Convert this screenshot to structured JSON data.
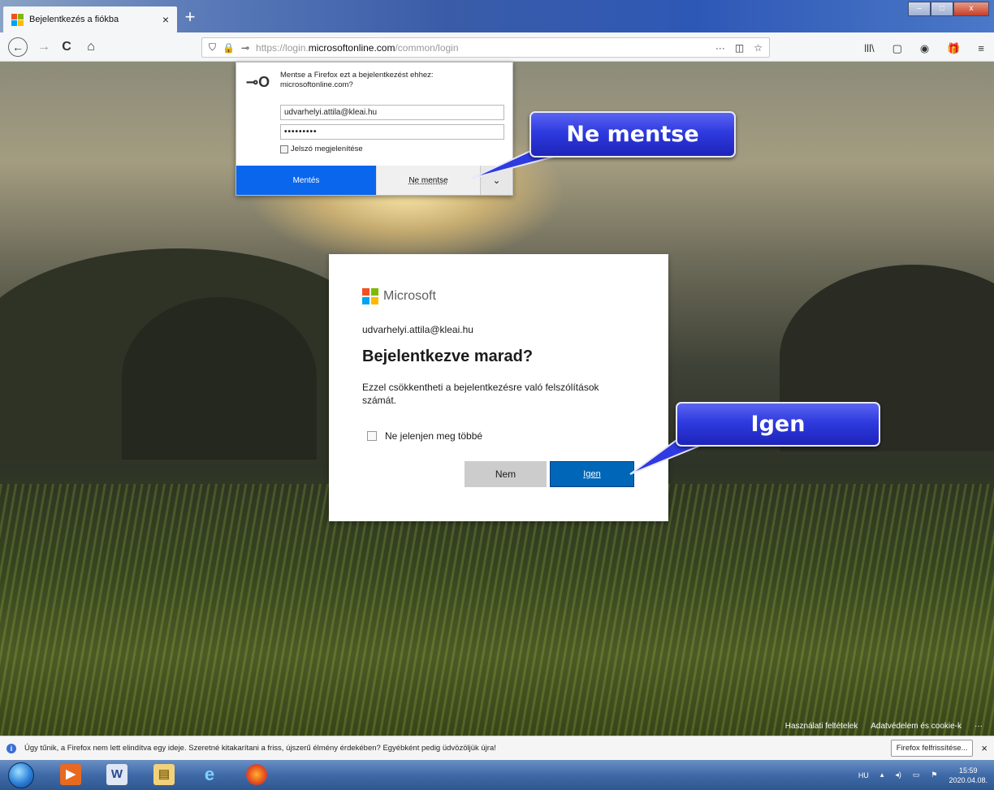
{
  "browser": {
    "tab_title": "Bejelentkezés a fiókba",
    "tab_close": "×",
    "new_tab": "+",
    "nav": {
      "back": "←",
      "forward": "→",
      "reload": "C",
      "home": "⌂"
    },
    "url": {
      "prefix": "https://login.",
      "host": "microsoftonline.com",
      "path": "/common/login"
    },
    "url_actions": [
      "···",
      "◫",
      "☆"
    ],
    "right_tools": [
      "lll\\",
      "▢",
      "◉",
      "🎁",
      "≡"
    ]
  },
  "save_prompt": {
    "message": "Mentse a Firefox ezt a bejelentkezést ehhez: microsoftonline.com?",
    "username": "udvarhelyi.attila@kleai.hu",
    "password": "•••••••••",
    "show_password_label": "Jelszó megjelenítése",
    "save_label": "Mentés",
    "dont_save_label": "Ne mentse",
    "dropdown": "⌄"
  },
  "callouts": {
    "dont_save": "Ne mentse",
    "yes": "Igen"
  },
  "ms_dialog": {
    "brand": "Microsoft",
    "email": "udvarhelyi.attila@kleai.hu",
    "title": "Bejelentkezve marad?",
    "description": "Ezzel csökkentheti a bejelentkezésre való felszólítások számát.",
    "checkbox_label": "Ne jelenjen meg többé",
    "no_label": "Nem",
    "yes_label": "Igen"
  },
  "footer": {
    "terms": "Használati feltételek",
    "privacy": "Adatvédelem és cookie-k",
    "more": "···"
  },
  "notification": {
    "message": "Úgy tűnik, a Firefox nem lett elindítva egy ideje. Szeretné kitakarítani a friss, újszerű élmény érdekében? Egyébként pedig üdvözöljük újra!",
    "refresh_label": "Firefox felfrissítése...",
    "close": "×"
  },
  "taskbar": {
    "language": "HU",
    "time": "15:59",
    "date": "2020.04.08."
  },
  "colors": {
    "ms_blue": "#0067b8",
    "firefox_blue": "#0a66ec",
    "callout_blue": "#2f3ae0"
  }
}
